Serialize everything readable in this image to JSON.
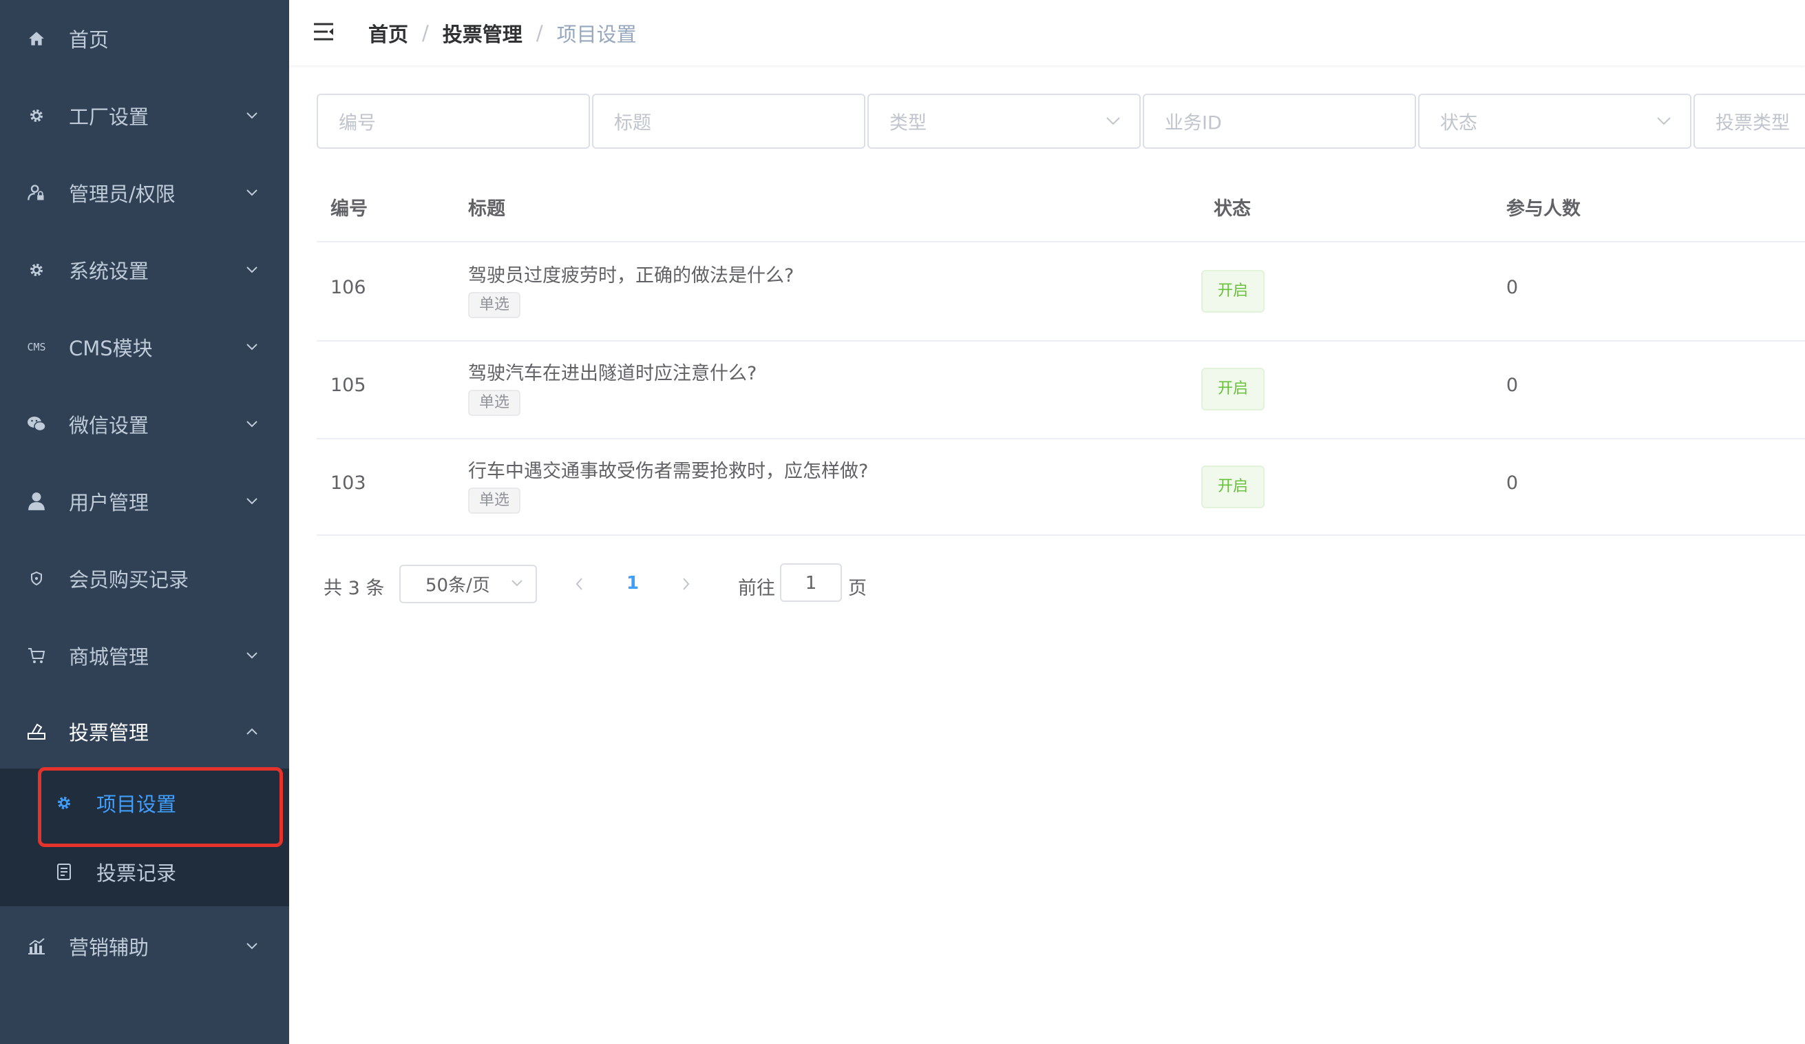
{
  "sidebar": {
    "items": [
      {
        "label": "首页",
        "icon": "home-icon",
        "has_arrow": false
      },
      {
        "label": "工厂设置",
        "icon": "gear-icon",
        "has_arrow": true
      },
      {
        "label": "管理员/权限",
        "icon": "user-lock-icon",
        "has_arrow": true
      },
      {
        "label": "系统设置",
        "icon": "gear-icon",
        "has_arrow": true
      },
      {
        "label": "CMS模块",
        "icon": "cms-icon",
        "icon_text": "CMS",
        "has_arrow": true
      },
      {
        "label": "微信设置",
        "icon": "wechat-icon",
        "has_arrow": true
      },
      {
        "label": "用户管理",
        "icon": "user-icon",
        "has_arrow": true
      },
      {
        "label": "会员购买记录",
        "icon": "shield-icon",
        "has_arrow": false
      },
      {
        "label": "商城管理",
        "icon": "cart-icon",
        "has_arrow": true
      },
      {
        "label": "投票管理",
        "icon": "vote-icon",
        "has_arrow": true,
        "expanded": true
      },
      {
        "label": "营销辅助",
        "icon": "chart-icon",
        "has_arrow": true
      }
    ],
    "submenu": [
      {
        "label": "项目设置",
        "icon": "gear-icon",
        "active": true
      },
      {
        "label": "投票记录",
        "icon": "document-icon",
        "active": false
      }
    ],
    "colors": {
      "bg": "#304156",
      "submenu_bg": "#1f2d3d",
      "text": "#bfcbd9",
      "active": "#409eff",
      "highlight": "#e5332b"
    }
  },
  "navbar": {
    "breadcrumb": [
      "首页",
      "投票管理",
      "项目设置"
    ],
    "separator": "/"
  },
  "filters": [
    {
      "placeholder": "编号",
      "type": "input"
    },
    {
      "placeholder": "标题",
      "type": "input"
    },
    {
      "placeholder": "类型",
      "type": "select"
    },
    {
      "placeholder": "业务ID",
      "type": "input"
    },
    {
      "placeholder": "状态",
      "type": "select"
    },
    {
      "placeholder": "投票类型",
      "type": "select"
    }
  ],
  "table": {
    "columns": [
      "编号",
      "标题",
      "状态",
      "参与人数"
    ],
    "rows": [
      {
        "id": "106",
        "title": "驾驶员过度疲劳时，正确的做法是什么?",
        "type_tag": "单选",
        "status": "开启",
        "participants": "0"
      },
      {
        "id": "105",
        "title": "驾驶汽车在进出隧道时应注意什么?",
        "type_tag": "单选",
        "status": "开启",
        "participants": "0"
      },
      {
        "id": "103",
        "title": "行车中遇交通事故受伤者需要抢救时，应怎样做?",
        "type_tag": "单选",
        "status": "开启",
        "participants": "0"
      }
    ]
  },
  "pagination": {
    "total": "共 3 条",
    "page_size": "50条/页",
    "current_page": "1",
    "goto_label": "前往",
    "goto_value": "1",
    "page_unit": "页"
  }
}
